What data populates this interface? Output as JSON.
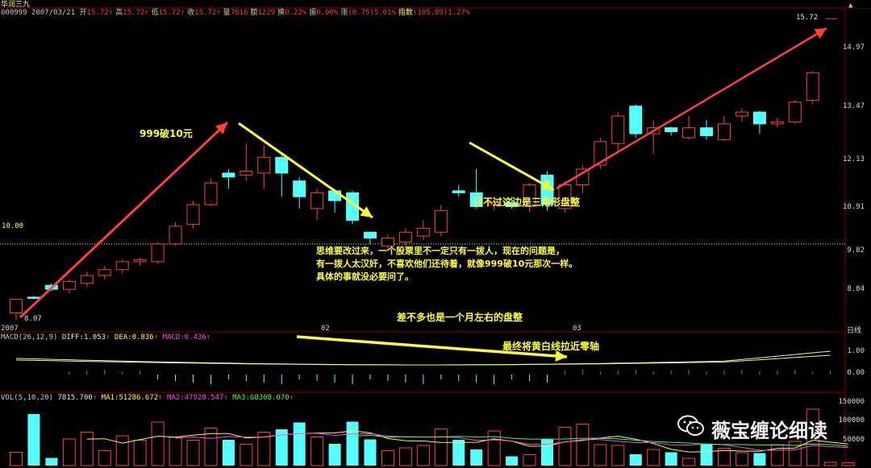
{
  "colors": {
    "up": "#ff4040",
    "down": "#54ffff",
    "yellow": "#ffff33",
    "magenta": "#ff44ff",
    "green": "#44ff44",
    "grid": "#8b0000",
    "white": "#e8e8e8"
  },
  "header": {
    "stock_name": "华润三九",
    "code_date": "000999 2007/03/21",
    "fields": [
      {
        "label": "开",
        "value": "15.72"
      },
      {
        "label": "高",
        "value": "15.72"
      },
      {
        "label": "低",
        "value": "15.72"
      },
      {
        "label": "收",
        "value": "15.72"
      },
      {
        "label": "量",
        "value": "7816"
      },
      {
        "label": "额",
        "value": "1229"
      },
      {
        "label": "换",
        "value": "0.22%"
      },
      {
        "label": "振",
        "value": "0.00%"
      },
      {
        "label": "涨",
        "value": "(0.75)5.01%"
      },
      {
        "label": "指数",
        "value": "(105.89)1.27%"
      }
    ],
    "up_arrow": "↑"
  },
  "price_axis": {
    "ticks": [
      "14.97",
      "13.47",
      "12.13",
      "10.91",
      "9.82",
      "8.84"
    ],
    "top_label": "15.72",
    "ref_line_label": "10.00",
    "low_label": "8.07"
  },
  "time_axis": {
    "labels": [
      "2007",
      "02",
      "03"
    ],
    "period": "日线"
  },
  "macd": {
    "title": "MACD(26,12,9)",
    "diff": "DIFF:1.053",
    "dea": "DEA:0.836",
    "macd": "MACD:0.436",
    "ticks": [
      "1.00",
      "0.00"
    ]
  },
  "vol": {
    "title": "VOL(5,10,20)",
    "value": "7815.700",
    "ma1": "MA1:51286.672",
    "ma2": "MA2:47920.547",
    "ma3": "MA3:68308.070",
    "ticks": [
      "150000",
      "100000",
      "50000"
    ]
  },
  "annotations": {
    "a1": "999破10元",
    "a2": "只不过这边是三角形盘整",
    "a3_lines": [
      "思维要改过来，一个股票里不一定只有一拨人，现在的问题是，",
      "有一拨人太汉奸，不喜欢他们还待着，就像999破10元那次一样。",
      "具体的事就没必要问了。"
    ],
    "a4": "差不多也是一个月左右的盘整",
    "a5": "最终将黄白线拉近零轴"
  },
  "watermark": "薇宝缠论细读",
  "chart_data": {
    "type": "candlestick",
    "candles": [
      [
        8.25,
        8.6,
        8.2,
        8.07
      ],
      [
        8.65,
        8.62,
        8.68,
        8.6
      ],
      [
        8.95,
        8.85,
        9.0,
        8.8
      ],
      [
        8.85,
        9.05,
        9.1,
        8.75
      ],
      [
        9.0,
        9.2,
        9.3,
        8.9
      ],
      [
        9.2,
        9.35,
        9.45,
        9.1
      ],
      [
        9.35,
        9.55,
        9.6,
        9.25
      ],
      [
        9.55,
        9.6,
        9.65,
        9.45
      ],
      [
        9.55,
        10.0,
        10.05,
        9.5
      ],
      [
        10.0,
        10.45,
        10.55,
        9.95
      ],
      [
        10.5,
        11.0,
        11.1,
        10.4
      ],
      [
        11.0,
        11.55,
        11.65,
        10.95
      ],
      [
        11.8,
        11.7,
        11.9,
        11.4
      ],
      [
        11.75,
        11.85,
        12.55,
        11.6
      ],
      [
        11.8,
        12.2,
        12.5,
        11.4
      ],
      [
        12.2,
        11.8,
        12.25,
        11.2
      ],
      [
        11.6,
        11.2,
        11.7,
        10.9
      ],
      [
        10.9,
        11.3,
        11.4,
        10.6
      ],
      [
        11.35,
        11.1,
        11.4,
        10.8
      ],
      [
        11.3,
        10.6,
        11.35,
        10.5
      ],
      [
        10.3,
        10.15,
        10.3,
        10.0
      ],
      [
        9.95,
        10.15,
        10.25,
        9.8
      ],
      [
        10.05,
        10.3,
        10.4,
        9.9
      ],
      [
        10.2,
        10.4,
        10.6,
        10.1
      ],
      [
        10.3,
        10.85,
        11.0,
        10.2
      ],
      [
        11.35,
        11.3,
        11.5,
        11.2
      ],
      [
        11.3,
        10.95,
        11.9,
        10.9
      ],
      [
        11.0,
        11.05,
        11.2,
        10.85
      ],
      [
        11.05,
        10.95,
        11.2,
        10.9
      ],
      [
        10.95,
        11.5,
        11.55,
        10.8
      ],
      [
        11.75,
        11.0,
        11.85,
        10.85
      ],
      [
        10.9,
        11.5,
        11.6,
        10.8
      ],
      [
        11.5,
        11.9,
        12.0,
        11.3
      ],
      [
        12.0,
        12.6,
        12.7,
        11.9
      ],
      [
        12.55,
        13.25,
        13.35,
        12.3
      ],
      [
        13.5,
        12.8,
        13.55,
        12.7
      ],
      [
        12.8,
        12.95,
        13.15,
        12.3
      ],
      [
        12.95,
        12.85,
        12.98,
        12.75
      ],
      [
        12.7,
        12.95,
        13.25,
        12.65
      ],
      [
        12.95,
        12.75,
        13.15,
        12.65
      ],
      [
        12.65,
        13.05,
        13.25,
        12.6
      ],
      [
        13.25,
        13.35,
        13.45,
        13.1
      ],
      [
        13.35,
        13.05,
        13.38,
        12.8
      ],
      [
        13.05,
        13.1,
        13.2,
        12.95
      ],
      [
        13.1,
        13.6,
        13.65,
        13.05
      ],
      [
        13.65,
        14.35,
        14.4,
        13.55
      ],
      [
        15.72,
        15.72,
        15.72,
        15.72
      ]
    ],
    "volume": [
      33000,
      128000,
      19000,
      66000,
      83000,
      37000,
      74000,
      63000,
      108000,
      70000,
      63000,
      93000,
      64000,
      53000,
      83000,
      90000,
      107000,
      71000,
      54000,
      109000,
      65000,
      37000,
      44000,
      50000,
      91000,
      64000,
      40000,
      86000,
      23000,
      27000,
      65000,
      95000,
      103000,
      52000,
      50000,
      28000,
      40000,
      33000,
      18000,
      54000,
      43000,
      32000,
      31000,
      52000,
      60000,
      140000,
      8000,
      7000
    ]
  }
}
